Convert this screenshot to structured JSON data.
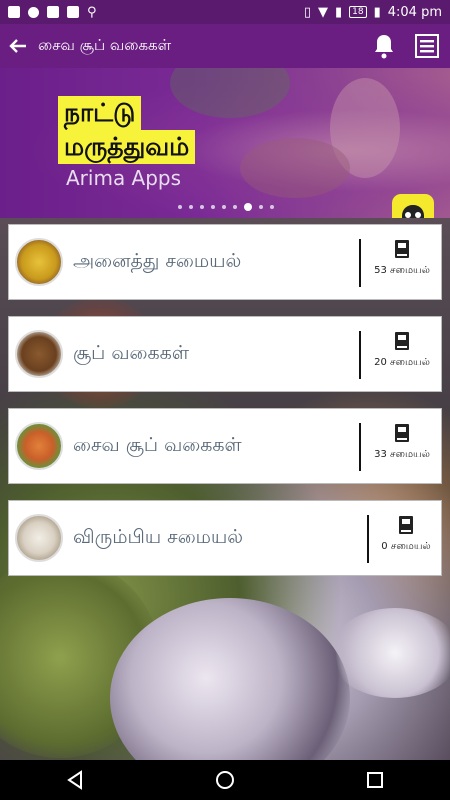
{
  "status_bar": {
    "time": "4:04 pm",
    "battery": "18"
  },
  "app_bar": {
    "title": "சைவ சூப் வகைகள்",
    "back_icon": "arrow-left-icon",
    "bell_icon": "bell-icon",
    "menu_icon": "list-icon"
  },
  "banner": {
    "line1": "நாட்டு",
    "line2": "மருத்துவம்",
    "subtitle": "Arima Apps",
    "dots_total": 9,
    "active_dot": 7
  },
  "categories": [
    {
      "title": "அனைத்து சமையல்",
      "count": "53 சமையல்"
    },
    {
      "title": "சூப் வகைகள்",
      "count": "20 சமையல்"
    },
    {
      "title": "சைவ சூப் வகைகள்",
      "count": "33 சமையல்"
    },
    {
      "title": "விரும்பிய சமையல்",
      "count": "0 சமையல்"
    }
  ],
  "colors": {
    "primary": "#6a1e82",
    "status_bar": "#5a1a6e",
    "accent_yellow": "#f7f23a",
    "card_text": "#5a6a7a"
  }
}
